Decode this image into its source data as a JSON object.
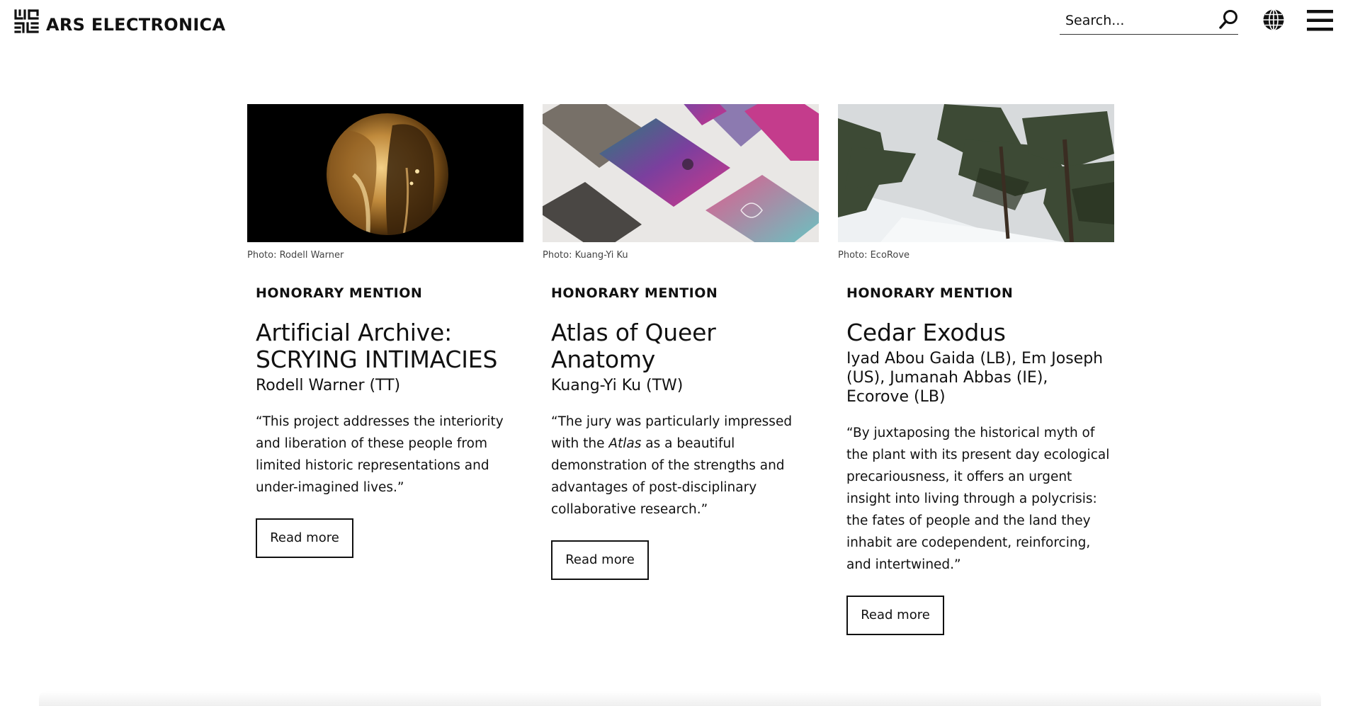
{
  "header": {
    "brand": "ARS ELECTRONICA",
    "search_placeholder": "Search..."
  },
  "icons": {
    "logo": "ars-electronica-logo-mark",
    "search": "search-icon",
    "globe": "globe-icon",
    "menu": "hamburger-menu-icon"
  },
  "cards": [
    {
      "image_alt": "Golden circular portrait of two women kissing on black background",
      "credit": "Photo: Rodell Warner",
      "category": "HONORARY MENTION",
      "title_line1": "Artificial Archive:",
      "title_line2": "SCRYING INTIMACIES",
      "author": "Rodell Warner (TT)",
      "quote": "“This project addresses the interiority and liberation of these people from limited historic representations and under-imagined lives.”",
      "button": "Read more"
    },
    {
      "image_alt": "Colorful printed atlas pages laid out diagonally",
      "credit": "Photo: Kuang-Yi Ku",
      "category": "HONORARY MENTION",
      "title_line1": "Atlas of Queer Anatomy",
      "author": "Kuang-Yi Ku (TW)",
      "quote_part1": "“The jury was particularly impressed with the ",
      "quote_em": "Atlas",
      "quote_part2": " as a beautiful demonstration of the strengths and advantages of post-disciplinary collaborative research.”",
      "button": "Read more"
    },
    {
      "image_alt": "Cedar trees on a snowy mountain slope",
      "credit": "Photo: EcoRove",
      "category": "HONORARY MENTION",
      "title_line1": "Cedar Exodus",
      "author": "Iyad Abou Gaida (LB), Em Joseph (US), Jumanah Abbas (IE), Ecorove (LB)",
      "quote": "“By juxtaposing the historical myth of the plant with its present day ecological precariousness, it offers an urgent insight into living through a polycrisis: the fates of people and the land they inhabit are codependent, reinforcing, and intertwined.”",
      "button": "Read more"
    }
  ]
}
